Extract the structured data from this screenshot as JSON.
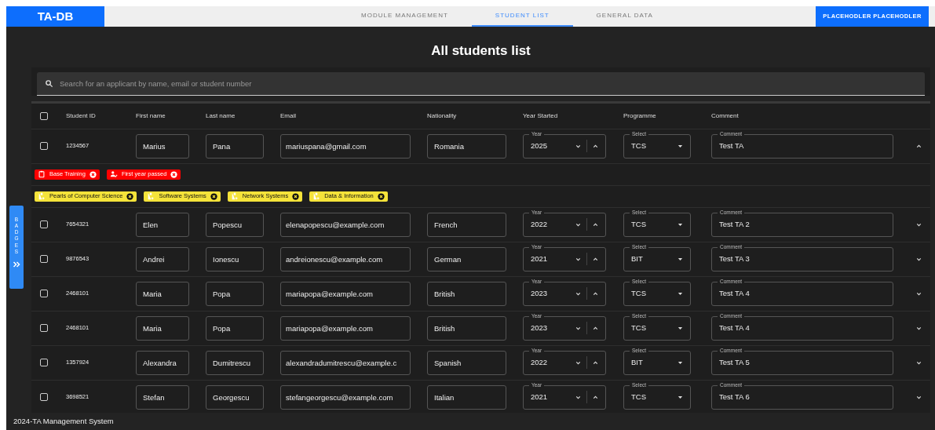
{
  "navbar": {
    "logo": "TA-DB",
    "tabs": [
      {
        "label": "MODULE MANAGEMENT",
        "selected": false
      },
      {
        "label": "STUDENT LIST",
        "selected": true
      },
      {
        "label": "GENERAL DATA",
        "selected": false
      }
    ],
    "user_button": "PLACEHODLER PLACEHODLER"
  },
  "title": "All students list",
  "search": {
    "placeholder": "Search for an applicant by name, email or student number"
  },
  "side_tab": {
    "label": "BADGES"
  },
  "table": {
    "header_checked": false,
    "columns": [
      "Student ID",
      "First name",
      "Last name",
      "Email",
      "Nationality",
      "Year Started",
      "Programme",
      "Comment"
    ],
    "rows": [
      {
        "checked": false,
        "student_id": "1234567",
        "first_name": "Marius",
        "last_name": "Pana",
        "email": "mariuspana@gmail.com",
        "nationality": "Romania",
        "year_label": "Year",
        "year": "2025",
        "programme_label": "Select",
        "programme": "TCS",
        "comment_label": "Comment",
        "comment": "Test TA",
        "expanded": true,
        "badge_groups": [
          {
            "kind": "achievement",
            "badges": [
              {
                "label": "Base Training",
                "kind": "clipboard"
              },
              {
                "label": "First year passed",
                "kind": "person"
              }
            ]
          },
          {
            "kind": "module",
            "badges": [
              {
                "label": "Pearls of Computer Science",
                "kind": "module"
              },
              {
                "label": "Software Systems",
                "kind": "module"
              },
              {
                "label": "Network Systems",
                "kind": "module"
              },
              {
                "label": "Data & Information",
                "kind": "module"
              }
            ]
          }
        ]
      },
      {
        "checked": false,
        "student_id": "7654321",
        "first_name": "Elen",
        "last_name": "Popescu",
        "email": "elenapopescu@example.com",
        "nationality": "French",
        "year_label": "Year",
        "year": "2022",
        "programme_label": "Select",
        "programme": "TCS",
        "comment_label": "Comment",
        "comment": "Test TA 2",
        "expanded": false
      },
      {
        "checked": false,
        "student_id": "9876543",
        "first_name": "Andrei",
        "last_name": "Ionescu",
        "email": "andreionescu@example.com",
        "nationality": "German",
        "year_label": "Year",
        "year": "2021",
        "programme_label": "Select",
        "programme": "BIT",
        "comment_label": "Comment",
        "comment": "Test TA 3",
        "expanded": false
      },
      {
        "checked": false,
        "student_id": "2468101",
        "first_name": "Maria",
        "last_name": "Popa",
        "email": "mariapopa@example.com",
        "nationality": "British",
        "year_label": "Year",
        "year": "2023",
        "programme_label": "Select",
        "programme": "TCS",
        "comment_label": "Comment",
        "comment": "Test TA 4",
        "expanded": false
      },
      {
        "checked": false,
        "student_id": "2468101",
        "first_name": "Maria",
        "last_name": "Popa",
        "email": "mariapopa@example.com",
        "nationality": "British",
        "year_label": "Year",
        "year": "2023",
        "programme_label": "Select",
        "programme": "TCS",
        "comment_label": "Comment",
        "comment": "Test TA 4",
        "expanded": false
      },
      {
        "checked": false,
        "student_id": "1357924",
        "first_name": "Alexandra",
        "last_name": "Dumitrescu",
        "email": "alexandradumitrescu@example.c",
        "nationality": "Spanish",
        "year_label": "Year",
        "year": "2022",
        "programme_label": "Select",
        "programme": "BIT",
        "comment_label": "Comment",
        "comment": "Test TA 5",
        "expanded": false
      },
      {
        "checked": false,
        "student_id": "3698521",
        "first_name": "Stefan",
        "last_name": "Georgescu",
        "email": "stefangeorgescu@example.com",
        "nationality": "Italian",
        "year_label": "Year",
        "year": "2021",
        "programme_label": "Select",
        "programme": "TCS",
        "comment_label": "Comment",
        "comment": "Test TA 6",
        "expanded": false
      }
    ]
  },
  "footer": "2024-TA Management System"
}
